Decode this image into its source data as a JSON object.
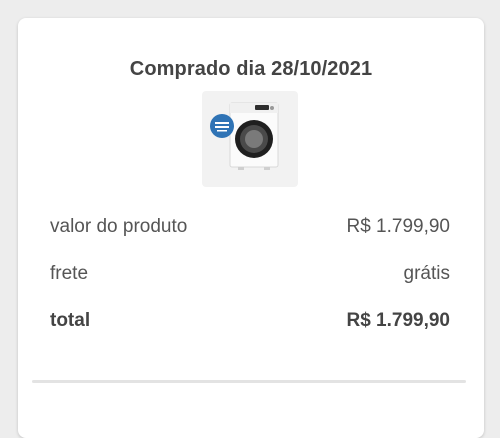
{
  "order": {
    "purchase_date_text": "Comprado dia 28/10/2021",
    "product_image": {
      "icon": "washing-machine-product-image",
      "badge_color": "#2f73b5"
    }
  },
  "summary": {
    "rows": [
      {
        "label": "valor do produto",
        "value": "R$ 1.799,90"
      },
      {
        "label": "frete",
        "value": "grátis"
      },
      {
        "label": "total",
        "value": "R$ 1.799,90"
      }
    ]
  },
  "colors": {
    "background": "#ededed",
    "card": "#ffffff",
    "text": "#555555",
    "title": "#444444"
  }
}
